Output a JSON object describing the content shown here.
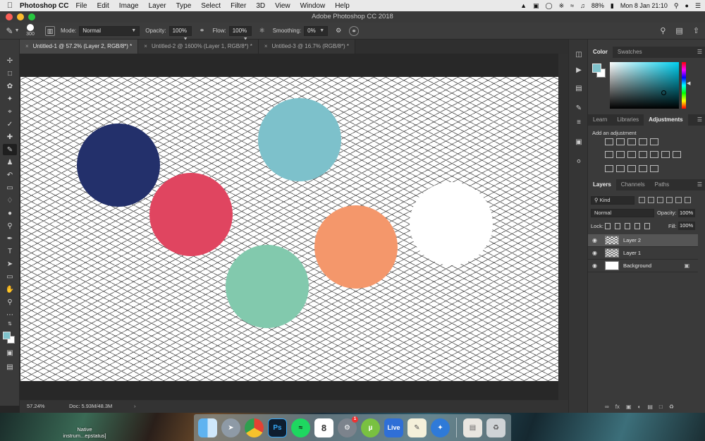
{
  "menubar": {
    "app_name": "Photoshop CC",
    "items": [
      "File",
      "Edit",
      "Image",
      "Layer",
      "Type",
      "Select",
      "Filter",
      "3D",
      "View",
      "Window",
      "Help"
    ],
    "battery": "88%",
    "clock": "Mon 8 Jan  21:10"
  },
  "window": {
    "title": "Adobe Photoshop CC 2018"
  },
  "options": {
    "brush_size": "300",
    "mode_label": "Mode:",
    "mode_value": "Normal",
    "opacity_label": "Opacity:",
    "opacity_value": "100%",
    "flow_label": "Flow:",
    "flow_value": "100%",
    "smoothing_label": "Smoothing:",
    "smoothing_value": "0%"
  },
  "doc_tabs": [
    {
      "label": "Untitled-1 @ 57.2% (Layer 2, RGB/8*) *",
      "active": true
    },
    {
      "label": "Untitled-2 @ 1600% (Layer 1, RGB/8*) *",
      "active": false
    },
    {
      "label": "Untitled-3 @ 16.7% (RGB/8*) *",
      "active": false
    }
  ],
  "colors": {
    "foreground": "#7fc2cb",
    "background": "#ffffff",
    "circles": [
      "#23306b",
      "#e04560",
      "#7dc1cb",
      "#82c9ad",
      "#f4976b",
      "#ffffff"
    ]
  },
  "status": {
    "zoom": "57.24%",
    "doc": "Doc: 5.93M/48.3M"
  },
  "panels": {
    "color_tabs": [
      "Color",
      "Swatches"
    ],
    "adj_tabs": [
      "Learn",
      "Libraries",
      "Adjustments"
    ],
    "adj_title": "Add an adjustment",
    "layer_tabs": [
      "Layers",
      "Channels",
      "Paths"
    ],
    "kind_value": "Kind",
    "blend_value": "Normal",
    "opacity_label": "Opacity:",
    "opacity_value": "100%",
    "lock_label": "Lock:",
    "fill_label": "Fill:",
    "fill_value": "100%",
    "layers": [
      {
        "name": "Layer 2",
        "selected": true
      },
      {
        "name": "Layer 1",
        "selected": false
      },
      {
        "name": "Background",
        "selected": false,
        "locked": true
      }
    ]
  },
  "dock": {
    "calendar_day": "8",
    "badge": "1",
    "live_label": "Live",
    "desktop_label": "Native\ninstrum...epstatus]"
  }
}
